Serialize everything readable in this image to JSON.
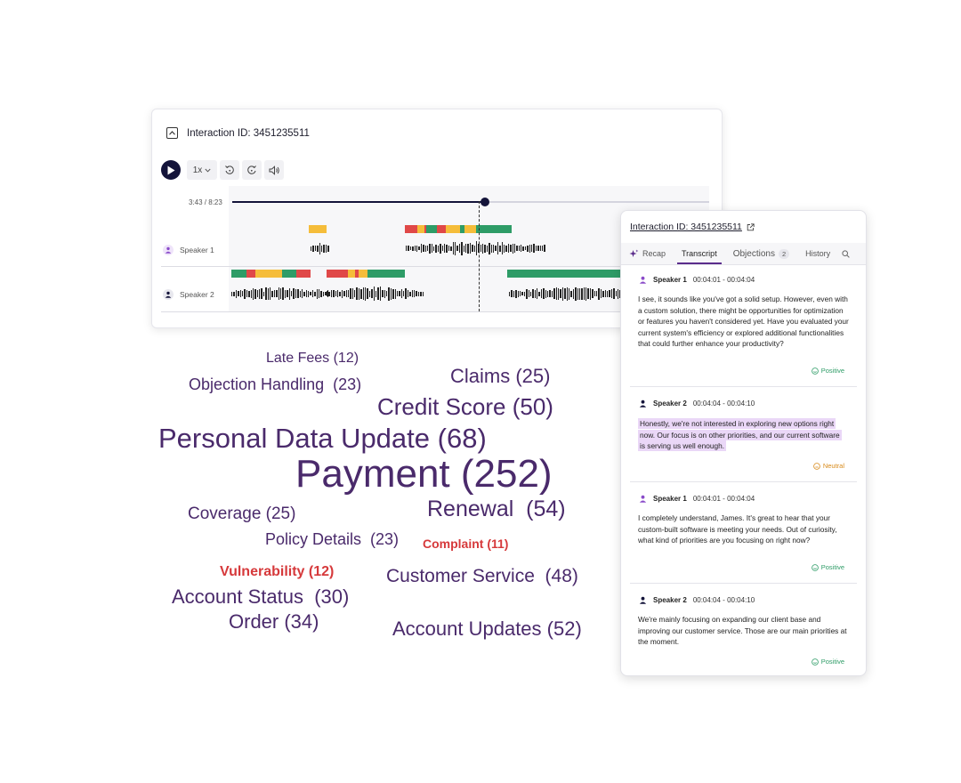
{
  "player": {
    "title": "Interaction ID: 3451235511",
    "speed": "1x",
    "time": "3:43 / 8:23",
    "progress": 0.53,
    "speakers": [
      {
        "label": "Speaker 1",
        "avatar_color": "#8a4bc9"
      },
      {
        "label": "Speaker 2",
        "avatar_color": "#14143a"
      }
    ]
  },
  "word_cloud": [
    {
      "text": "Late Fees (12)",
      "alert": false
    },
    {
      "text": "Claims (25)",
      "alert": false
    },
    {
      "text": "Objection Handling  (23)",
      "alert": false
    },
    {
      "text": "Credit Score (50)",
      "alert": false
    },
    {
      "text": "Personal Data Update (68)",
      "alert": false
    },
    {
      "text": "Payment (252)",
      "alert": false
    },
    {
      "text": "Coverage (25)",
      "alert": false
    },
    {
      "text": "Renewal  (54)",
      "alert": false
    },
    {
      "text": "Policy Details  (23)",
      "alert": false
    },
    {
      "text": "Complaint (11)",
      "alert": true
    },
    {
      "text": "Vulnerability (12)",
      "alert": true
    },
    {
      "text": "Customer Service  (48)",
      "alert": false
    },
    {
      "text": "Account Status  (30)",
      "alert": false
    },
    {
      "text": "Order (34)",
      "alert": false
    },
    {
      "text": "Account Updates (52)",
      "alert": false
    }
  ],
  "panel": {
    "title": "Interaction ID: 3451235511",
    "tabs": [
      {
        "label": "Recap"
      },
      {
        "label": "Transcript"
      },
      {
        "label": "Objections",
        "badge": "2"
      },
      {
        "label": "History"
      }
    ],
    "messages": [
      {
        "speaker": "Speaker 1",
        "time": "00:04:01 - 00:04:04",
        "text": "I see, it sounds like you've got a solid setup. However, even with a custom solution, there might be opportunities for optimization or features you haven't considered yet. Have you evaluated your current system's efficiency or explored additional functionalities that could further enhance your productivity?",
        "sentiment": "Positive"
      },
      {
        "speaker": "Speaker 2",
        "time": "00:04:04 - 00:04:10",
        "text": "Honestly, we're not interested in exploring new options right now. Our focus is on other priorities, and our current software is serving us well enough.",
        "sentiment": "Neutral"
      },
      {
        "speaker": "Speaker 1",
        "time": "00:04:01 - 00:04:04",
        "text": "I completely understand, James. It's great to hear that your custom-built software is meeting your needs. Out of curiosity, what kind of priorities are you focusing on right now?",
        "sentiment": "Positive"
      },
      {
        "speaker": "Speaker 2",
        "time": "00:04:04 - 00:04:10",
        "text": "We're mainly focusing on expanding our client base and improving our customer service. Those are our main priorities at the moment.",
        "sentiment": "Positive"
      }
    ]
  },
  "colors": {
    "positive": "#2e9c67",
    "neutral": "#d88a1a",
    "negative": "#e04848",
    "segment_green": "#2e9c67",
    "segment_yellow": "#f5bd3a",
    "segment_red": "#e04848",
    "word": "#4a2a6b",
    "alert": "#d6393b",
    "accent": "#5b2d8c"
  }
}
